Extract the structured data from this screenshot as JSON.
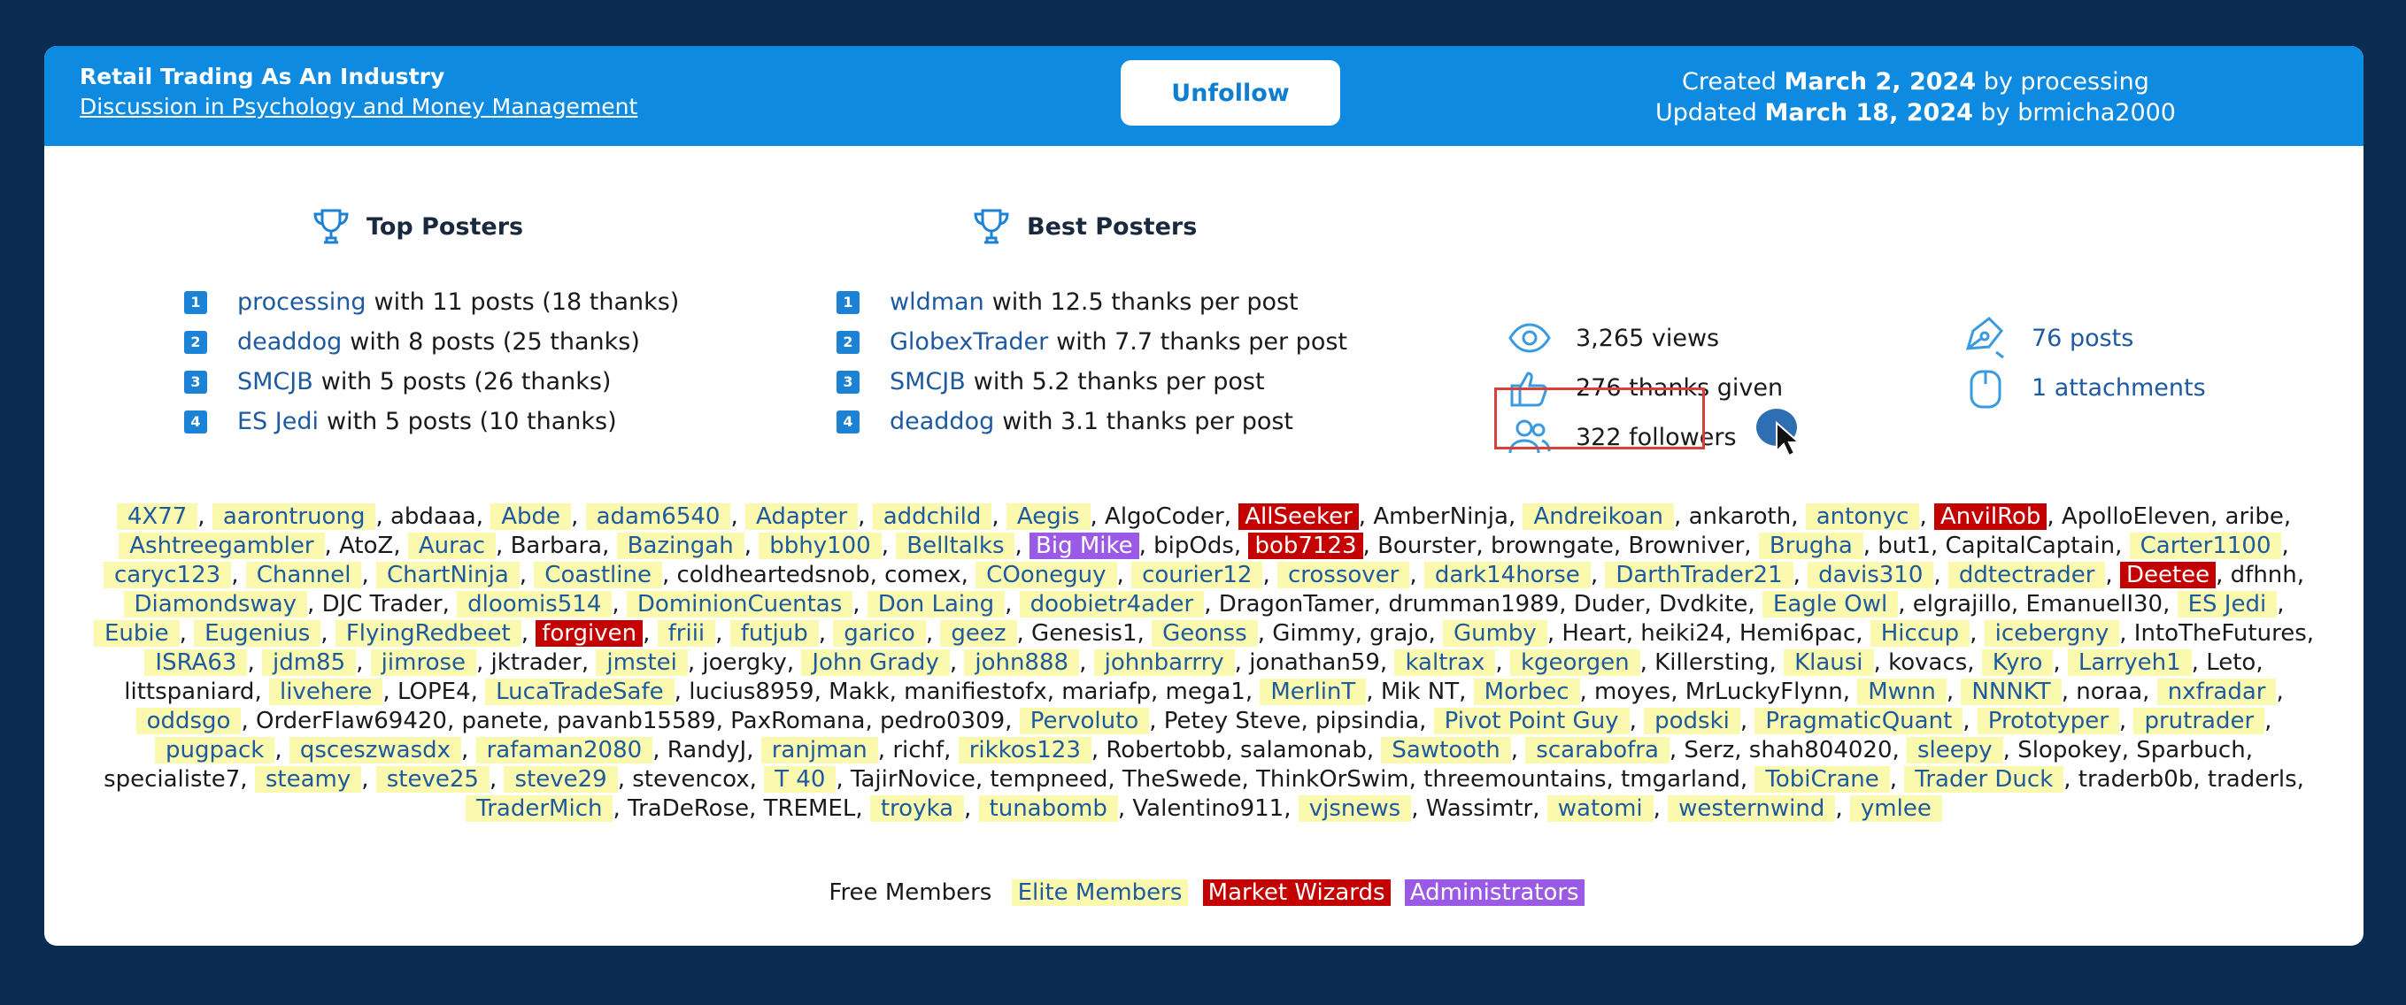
{
  "header": {
    "title": "Retail Trading As An Industry",
    "forum_link": "Discussion in Psychology and Money Management",
    "unfollow_label": "Unfollow",
    "created_prefix": "Created",
    "created_date": "March 2, 2024",
    "created_by_prefix": "by",
    "created_by": "processing",
    "updated_prefix": "Updated",
    "updated_date": "March 18, 2024",
    "updated_by_prefix": "by",
    "updated_by": "brmicha2000"
  },
  "top_posters": {
    "title": "Top Posters",
    "items": [
      {
        "rank": "1",
        "name": "processing",
        "detail": "with 11 posts (18 thanks)"
      },
      {
        "rank": "2",
        "name": "deaddog",
        "detail": "with 8 posts (25 thanks)"
      },
      {
        "rank": "3",
        "name": "SMCJB",
        "detail": "with 5 posts (26 thanks)"
      },
      {
        "rank": "4",
        "name": "ES Jedi",
        "detail": "with 5 posts (10 thanks)"
      }
    ]
  },
  "best_posters": {
    "title": "Best Posters",
    "items": [
      {
        "rank": "1",
        "name": "wldman",
        "detail": "with 12.5 thanks per post"
      },
      {
        "rank": "2",
        "name": "GlobexTrader",
        "detail": "with 7.7 thanks per post"
      },
      {
        "rank": "3",
        "name": "SMCJB",
        "detail": "with 5.2 thanks per post"
      },
      {
        "rank": "4",
        "name": "deaddog",
        "detail": "with 3.1 thanks per post"
      }
    ]
  },
  "stats": {
    "views": "3,265 views",
    "thanks": "276 thanks given",
    "followers": "322 followers",
    "posts": "76 posts",
    "attachments": "1 attachments"
  },
  "members": [
    {
      "n": "4X77",
      "t": "e"
    },
    {
      "n": "aarontruong",
      "t": "e"
    },
    {
      "n": "abdaaa",
      "t": "f"
    },
    {
      "n": "Abde",
      "t": "e"
    },
    {
      "n": "adam6540",
      "t": "e"
    },
    {
      "n": "Adapter",
      "t": "e"
    },
    {
      "n": "addchild",
      "t": "e"
    },
    {
      "n": "Aegis",
      "t": "e"
    },
    {
      "n": "AlgoCoder",
      "t": "f"
    },
    {
      "n": "AllSeeker",
      "t": "w"
    },
    {
      "n": "AmberNinja",
      "t": "f"
    },
    {
      "n": "Andreikoan",
      "t": "e"
    },
    {
      "n": "ankaroth",
      "t": "f"
    },
    {
      "n": "antonyc",
      "t": "e"
    },
    {
      "n": "AnvilRob",
      "t": "w"
    },
    {
      "n": "ApolloEleven",
      "t": "f"
    },
    {
      "n": "aribe",
      "t": "f"
    },
    {
      "n": "Ashtreegambler",
      "t": "e"
    },
    {
      "n": "AtoZ",
      "t": "f"
    },
    {
      "n": "Aurac",
      "t": "e"
    },
    {
      "n": "Barbara",
      "t": "f"
    },
    {
      "n": "Bazingah",
      "t": "e"
    },
    {
      "n": "bbhy100",
      "t": "e"
    },
    {
      "n": "Belltalks",
      "t": "e"
    },
    {
      "n": "Big Mike",
      "t": "a"
    },
    {
      "n": "bipOds",
      "t": "f"
    },
    {
      "n": "bob7123",
      "t": "w"
    },
    {
      "n": "Bourster",
      "t": "f"
    },
    {
      "n": "browngate",
      "t": "f"
    },
    {
      "n": "Browniver",
      "t": "f"
    },
    {
      "n": "Brugha",
      "t": "e"
    },
    {
      "n": "but1",
      "t": "f"
    },
    {
      "n": "CapitalCaptain",
      "t": "f"
    },
    {
      "n": "Carter1100",
      "t": "e"
    },
    {
      "n": "caryc123",
      "t": "e"
    },
    {
      "n": "Channel",
      "t": "e"
    },
    {
      "n": "ChartNinja",
      "t": "e"
    },
    {
      "n": "Coastline",
      "t": "e"
    },
    {
      "n": "coldheartedsnob",
      "t": "f"
    },
    {
      "n": "comex",
      "t": "f"
    },
    {
      "n": "COoneguy",
      "t": "e"
    },
    {
      "n": "courier12",
      "t": "e"
    },
    {
      "n": "crossover",
      "t": "e"
    },
    {
      "n": "dark14horse",
      "t": "e"
    },
    {
      "n": "DarthTrader21",
      "t": "e"
    },
    {
      "n": "davis310",
      "t": "e"
    },
    {
      "n": "ddtectrader",
      "t": "e"
    },
    {
      "n": "Deetee",
      "t": "w"
    },
    {
      "n": "dfhnh",
      "t": "f"
    },
    {
      "n": "Diamondsway",
      "t": "e"
    },
    {
      "n": "DJC Trader",
      "t": "f"
    },
    {
      "n": "dloomis514",
      "t": "e"
    },
    {
      "n": "DominionCuentas",
      "t": "e"
    },
    {
      "n": "Don Laing",
      "t": "e"
    },
    {
      "n": "doobietr4ader",
      "t": "e"
    },
    {
      "n": "DragonTamer",
      "t": "f"
    },
    {
      "n": "drumman1989",
      "t": "f"
    },
    {
      "n": "Duder",
      "t": "f"
    },
    {
      "n": "Dvdkite",
      "t": "f"
    },
    {
      "n": "Eagle Owl",
      "t": "e"
    },
    {
      "n": "elgrajillo",
      "t": "f"
    },
    {
      "n": "EmanuelI30",
      "t": "f"
    },
    {
      "n": "ES Jedi",
      "t": "e"
    },
    {
      "n": "Eubie",
      "t": "e"
    },
    {
      "n": "Eugenius",
      "t": "e"
    },
    {
      "n": "FlyingRedbeet",
      "t": "e"
    },
    {
      "n": "forgiven",
      "t": "w"
    },
    {
      "n": "friii",
      "t": "e"
    },
    {
      "n": "futjub",
      "t": "e"
    },
    {
      "n": "garico",
      "t": "e"
    },
    {
      "n": "geez",
      "t": "e"
    },
    {
      "n": "Genesis1",
      "t": "f"
    },
    {
      "n": "Geonss",
      "t": "e"
    },
    {
      "n": "Gimmy",
      "t": "f"
    },
    {
      "n": "grajo",
      "t": "f"
    },
    {
      "n": "Gumby",
      "t": "e"
    },
    {
      "n": "Heart",
      "t": "f"
    },
    {
      "n": "heiki24",
      "t": "f"
    },
    {
      "n": "Hemi6pac",
      "t": "f"
    },
    {
      "n": "Hiccup",
      "t": "e"
    },
    {
      "n": "icebergny",
      "t": "e"
    },
    {
      "n": "IntoTheFutures",
      "t": "f"
    },
    {
      "n": "ISRA63",
      "t": "e"
    },
    {
      "n": "jdm85",
      "t": "e"
    },
    {
      "n": "jimrose",
      "t": "e"
    },
    {
      "n": "jktrader",
      "t": "f"
    },
    {
      "n": "jmstei",
      "t": "e"
    },
    {
      "n": "joergky",
      "t": "f"
    },
    {
      "n": "John Grady",
      "t": "e"
    },
    {
      "n": "john888",
      "t": "e"
    },
    {
      "n": "johnbarrry",
      "t": "e"
    },
    {
      "n": "jonathan59",
      "t": "f"
    },
    {
      "n": "kaltrax",
      "t": "e"
    },
    {
      "n": "kgeorgen",
      "t": "e"
    },
    {
      "n": "Killersting",
      "t": "f"
    },
    {
      "n": "Klausi",
      "t": "e"
    },
    {
      "n": "kovacs",
      "t": "f"
    },
    {
      "n": "Kyro",
      "t": "e"
    },
    {
      "n": "Larryeh1",
      "t": "e"
    },
    {
      "n": "Leto",
      "t": "f"
    },
    {
      "n": "littspaniard",
      "t": "f"
    },
    {
      "n": "livehere",
      "t": "e"
    },
    {
      "n": "LOPE4",
      "t": "f"
    },
    {
      "n": "LucaTradeSafe",
      "t": "e"
    },
    {
      "n": "lucius8959",
      "t": "f"
    },
    {
      "n": "Makk",
      "t": "f"
    },
    {
      "n": "manifiestofx",
      "t": "f"
    },
    {
      "n": "mariafp",
      "t": "f"
    },
    {
      "n": "mega1",
      "t": "f"
    },
    {
      "n": "MerlinT",
      "t": "e"
    },
    {
      "n": "Mik NT",
      "t": "f"
    },
    {
      "n": "Morbec",
      "t": "e"
    },
    {
      "n": "moyes",
      "t": "f"
    },
    {
      "n": "MrLuckyFlynn",
      "t": "f"
    },
    {
      "n": "Mwnn",
      "t": "e"
    },
    {
      "n": "NNNKT",
      "t": "e"
    },
    {
      "n": "noraa",
      "t": "f"
    },
    {
      "n": "nxfradar",
      "t": "e"
    },
    {
      "n": "oddsgo",
      "t": "e"
    },
    {
      "n": "OrderFlaw69420",
      "t": "f"
    },
    {
      "n": "panete",
      "t": "f"
    },
    {
      "n": "pavanb15589",
      "t": "f"
    },
    {
      "n": "PaxRomana",
      "t": "f"
    },
    {
      "n": "pedro0309",
      "t": "f"
    },
    {
      "n": "Pervoluto",
      "t": "e"
    },
    {
      "n": "Petey Steve",
      "t": "f"
    },
    {
      "n": "pipsindia",
      "t": "f"
    },
    {
      "n": "Pivot Point Guy",
      "t": "e"
    },
    {
      "n": "podski",
      "t": "e"
    },
    {
      "n": "PragmaticQuant",
      "t": "e"
    },
    {
      "n": "Prototyper",
      "t": "e"
    },
    {
      "n": "prutrader",
      "t": "e"
    },
    {
      "n": "pugpack",
      "t": "e"
    },
    {
      "n": "qsceszwasdx",
      "t": "e"
    },
    {
      "n": "rafaman2080",
      "t": "e"
    },
    {
      "n": "RandyJ",
      "t": "f"
    },
    {
      "n": "ranjman",
      "t": "e"
    },
    {
      "n": "richf",
      "t": "f"
    },
    {
      "n": "rikkos123",
      "t": "e"
    },
    {
      "n": "Robertobb",
      "t": "f"
    },
    {
      "n": "salamonab",
      "t": "f"
    },
    {
      "n": "Sawtooth",
      "t": "e"
    },
    {
      "n": "scarabofra",
      "t": "e"
    },
    {
      "n": "Serz",
      "t": "f"
    },
    {
      "n": "shah804020",
      "t": "f"
    },
    {
      "n": "sleepy",
      "t": "e"
    },
    {
      "n": "Slopokey",
      "t": "f"
    },
    {
      "n": "Sparbuch",
      "t": "f"
    },
    {
      "n": "specialiste7",
      "t": "f"
    },
    {
      "n": "steamy",
      "t": "e"
    },
    {
      "n": "steve25",
      "t": "e"
    },
    {
      "n": "steve29",
      "t": "e"
    },
    {
      "n": "stevencox",
      "t": "f"
    },
    {
      "n": "T 40",
      "t": "e"
    },
    {
      "n": "TajirNovice",
      "t": "f"
    },
    {
      "n": "tempneed",
      "t": "f"
    },
    {
      "n": "TheSwede",
      "t": "f"
    },
    {
      "n": "ThinkOrSwim",
      "t": "f"
    },
    {
      "n": "threemountains",
      "t": "f"
    },
    {
      "n": "tmgarland",
      "t": "f"
    },
    {
      "n": "TobiCrane",
      "t": "e"
    },
    {
      "n": "Trader Duck",
      "t": "e"
    },
    {
      "n": "traderb0b",
      "t": "f"
    },
    {
      "n": "traderls",
      "t": "f"
    },
    {
      "n": "TraderMich",
      "t": "e"
    },
    {
      "n": "TraDeRose",
      "t": "f"
    },
    {
      "n": "TREMEL",
      "t": "f"
    },
    {
      "n": "troyka",
      "t": "e"
    },
    {
      "n": "tunabomb",
      "t": "e"
    },
    {
      "n": "Valentino911",
      "t": "f"
    },
    {
      "n": "vjsnews",
      "t": "e"
    },
    {
      "n": "Wassimtr",
      "t": "f"
    },
    {
      "n": "watomi",
      "t": "e"
    },
    {
      "n": "westernwind",
      "t": "e"
    },
    {
      "n": "ymlee",
      "t": "e"
    }
  ],
  "legend": {
    "free": "Free Members",
    "elite": "Elite Members",
    "wizards": "Market Wizards",
    "admins": "Administrators"
  },
  "colors": {
    "header": "#0e8be0",
    "background": "#0c2b52",
    "elite": "#fbf9ad",
    "wizard": "#c40000",
    "admin": "#9b5ae6",
    "rank_badge": "#1c82d6"
  }
}
